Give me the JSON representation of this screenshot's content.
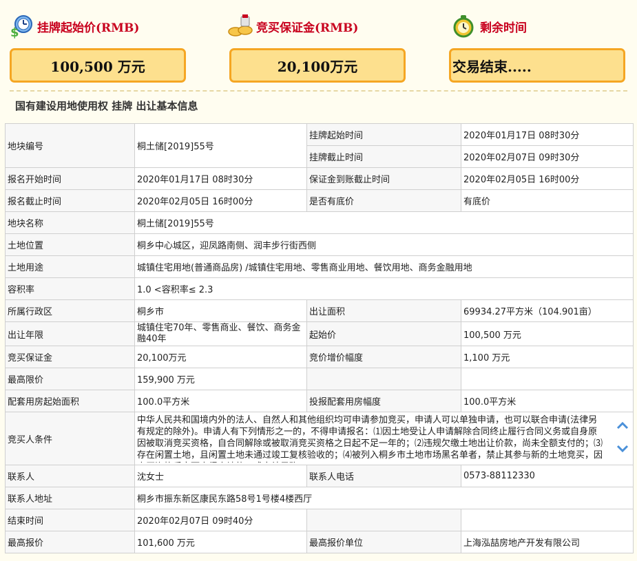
{
  "header": {
    "start_price_title": "挂牌起始价(RMB)",
    "deposit_title": "竞买保证金(RMB)",
    "remaining_title": "剩余时间",
    "start_price_value": "100,500 万元",
    "deposit_value": "20,100万元",
    "remaining_value": "交易结束....."
  },
  "section_title": "国有建设用地使用权 挂牌 出让基本信息",
  "rows": {
    "parcel_no_label": "地块编号",
    "parcel_no_value": "桐土储[2019]55号",
    "listing_start_label": "挂牌起始时间",
    "listing_start_value": "2020年01月17日 08时30分",
    "listing_end_label": "挂牌截止时间",
    "listing_end_value": "2020年02月07日 09时30分",
    "reg_start_label": "报名开始时间",
    "reg_start_value": "2020年01月17日 08时30分",
    "deposit_deadline_label": "保证金到账截止时间",
    "deposit_deadline_value": "2020年02月05日 16时00分",
    "reg_end_label": "报名截止时间",
    "reg_end_value": "2020年02月05日 16时00分",
    "reserve_label": "是否有底价",
    "reserve_value": "有底价",
    "parcel_name_label": "地块名称",
    "parcel_name_value": "桐土储[2019]55号",
    "location_label": "土地位置",
    "location_value": "桐乡中心城区，迎凤路南侧、润丰步行街西侧",
    "usage_label": "土地用途",
    "usage_value": "城镇住宅用地(普通商品房) /城镇住宅用地、零售商业用地、餐饮用地、商务金融用地",
    "far_label": "容积率",
    "far_value": "1.0 <容积率≤ 2.3",
    "district_label": "所属行政区",
    "district_value": "桐乡市",
    "area_label": "出让面积",
    "area_value": "69934.27平方米（104.901亩）",
    "term_label": "出让年限",
    "term_value": "城镇住宅70年、零售商业、餐饮、商务金融40年",
    "start_price_label": "起始价",
    "start_price_value": "100,500 万元",
    "deposit_label": "竞买保证金",
    "deposit_value": "20,100万元",
    "increment_label": "竞价增价幅度",
    "increment_value": "1,100 万元",
    "max_price_label": "最高限价",
    "max_price_value": "159,900 万元",
    "housing_start_label": "配套用房起始面积",
    "housing_start_value": "100.0平方米",
    "housing_step_label": "投报配套用房幅度",
    "housing_step_value": "100.0平方米",
    "conditions_label": "竞买人条件",
    "conditions_value": "中华人民共和国境内外的法人、自然人和其他组织均可申请参加竞买，申请人可以单独申请，也可以联合申请(法律另有规定的除外)。申请人有下列情形之一的，不得申请报名：⑴因土地受让人申请解除合同终止履行合同义务或自身原因被取消竞买资格，自合同解除或被取消竞买资格之日起不足一年的；⑵违规欠缴土地出让价款，尚未全额支付的；⑶存在闲置土地，且闲置土地未通过竣工复核验收的；⑷被列入桐乡市土地市场黑名单者，禁止其参与新的土地竞买，因竞买资格后审而竞得土地的，成交结果确",
    "contact_label": "联系人",
    "contact_value": "沈女士",
    "phone_label": "联系人电话",
    "phone_value": "0573-88112330",
    "address_label": "联系人地址",
    "address_value": "桐乡市振东新区康民东路58号1号楼4楼西厅",
    "end_time_label": "结束时间",
    "end_time_value": "2020年02月07日 09时40分",
    "top_bid_label": "最高报价",
    "top_bid_value": "101,600 万元",
    "top_bidder_label": "最高报价单位",
    "top_bidder_value": "上海泓喆房地产开发有限公司"
  },
  "icons": {
    "price": "money-clock-icon",
    "deposit": "coins-icon",
    "time": "alarm-clock-icon",
    "scroll_up": "chevron-up-icon",
    "scroll_down": "chevron-down-icon"
  },
  "colors": {
    "title_red": "#c8001e",
    "box_border": "#f5a623",
    "box_fill": "#fde08e"
  }
}
